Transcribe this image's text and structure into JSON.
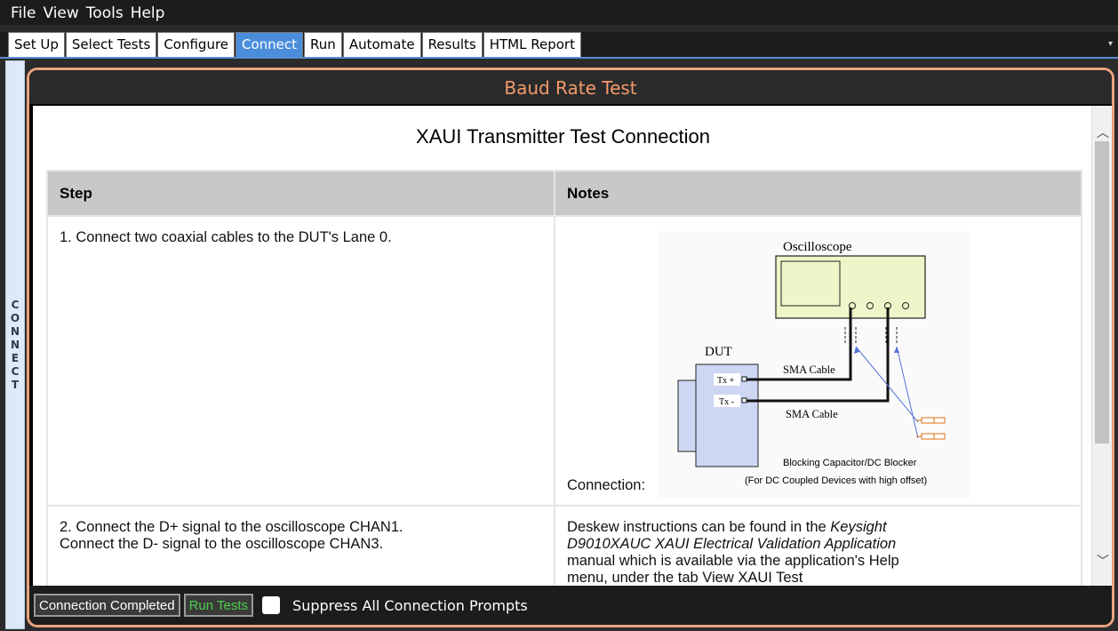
{
  "menu": [
    "File",
    "View",
    "Tools",
    "Help"
  ],
  "tabs": [
    {
      "label": "Set Up",
      "active": false
    },
    {
      "label": "Select Tests",
      "active": false
    },
    {
      "label": "Configure",
      "active": false
    },
    {
      "label": "Connect",
      "active": true
    },
    {
      "label": "Run",
      "active": false
    },
    {
      "label": "Automate",
      "active": false
    },
    {
      "label": "Results",
      "active": false
    },
    {
      "label": "HTML Report",
      "active": false
    }
  ],
  "side_label": "CONNECT",
  "panel_title": "Baud Rate Test",
  "heading": "XAUI Transmitter Test Connection",
  "table": {
    "headers": [
      "Step",
      "Notes"
    ],
    "rows": [
      {
        "step": "1. Connect two coaxial cables to the DUT's Lane 0.",
        "notes_label": "Connection:"
      },
      {
        "step": "2. Connect the D+ signal to the oscilloscope CHAN1. Connect the D- signal to the oscilloscope CHAN3.",
        "notes_pre": "Deskew instructions can be found in the ",
        "notes_italic": "Keysight D9010XAUC XAUI Electrical Validation Application",
        "notes_post": " manual which is available via the application's Help menu, under the tab View XAUI Test"
      }
    ]
  },
  "diagram": {
    "oscilloscope": "Oscilloscope",
    "dut": "DUT",
    "tx_plus": "Tx +",
    "tx_minus": "Tx -",
    "cable1": "SMA Cable",
    "cable2": "SMA Cable",
    "blocker1": "Blocking Capacitor/DC Blocker",
    "blocker2": "(For DC Coupled Devices with high offset)"
  },
  "bottom": {
    "connection_completed": "Connection Completed",
    "run_tests": "Run Tests",
    "suppress": "Suppress All Connection Prompts"
  },
  "colors": {
    "accent_tab": "#4a8edb",
    "frame_border": "#e8a37d",
    "title": "#f39a6b",
    "run_tests_text": "#4ccf4c"
  }
}
